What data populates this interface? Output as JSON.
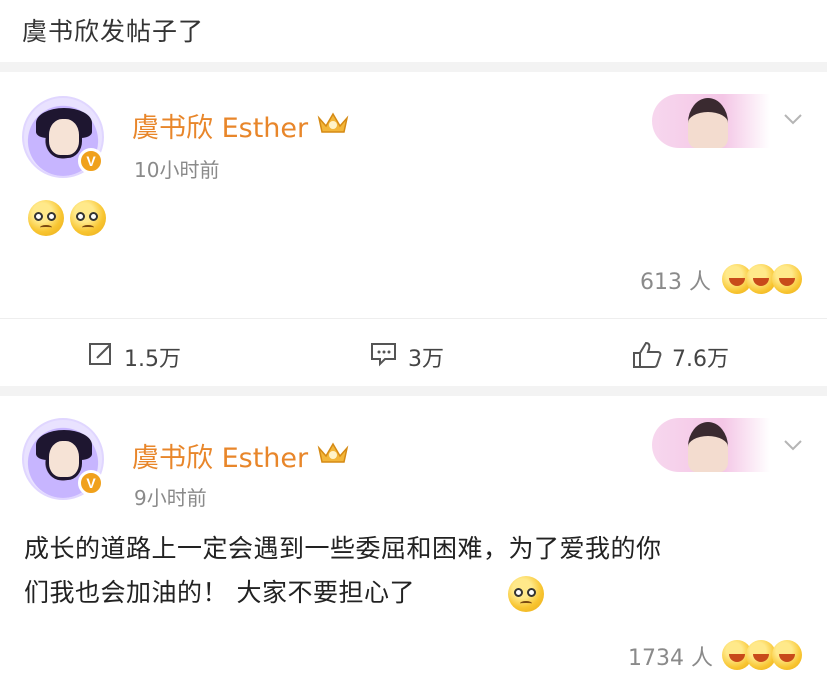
{
  "header": {
    "title": "虞书欣发帖子了"
  },
  "posts": [
    {
      "username": "虞书欣 Esther",
      "time": "10小时前",
      "reactions": "613 人",
      "actions": {
        "repost": "1.5万",
        "comment": "3万",
        "like": "7.6万"
      }
    },
    {
      "username": "虞书欣 Esther",
      "time": "9小时前",
      "text_line1": "成长的道路上一定会遇到一些委屈和困难，为了爱我的你",
      "text_line2": "们我也会加油的！ 大家不要担心了",
      "reactions": "1734 人"
    }
  ],
  "icons": {
    "verify": "v-badge-icon",
    "crown": "crown-icon",
    "chevron": "chevron-down-icon",
    "repost": "repost-icon",
    "comment": "comment-icon",
    "like": "thumbs-up-icon"
  },
  "colors": {
    "username": "#e8862a",
    "verify": "#f0a11c"
  },
  "badge_letter": "V"
}
